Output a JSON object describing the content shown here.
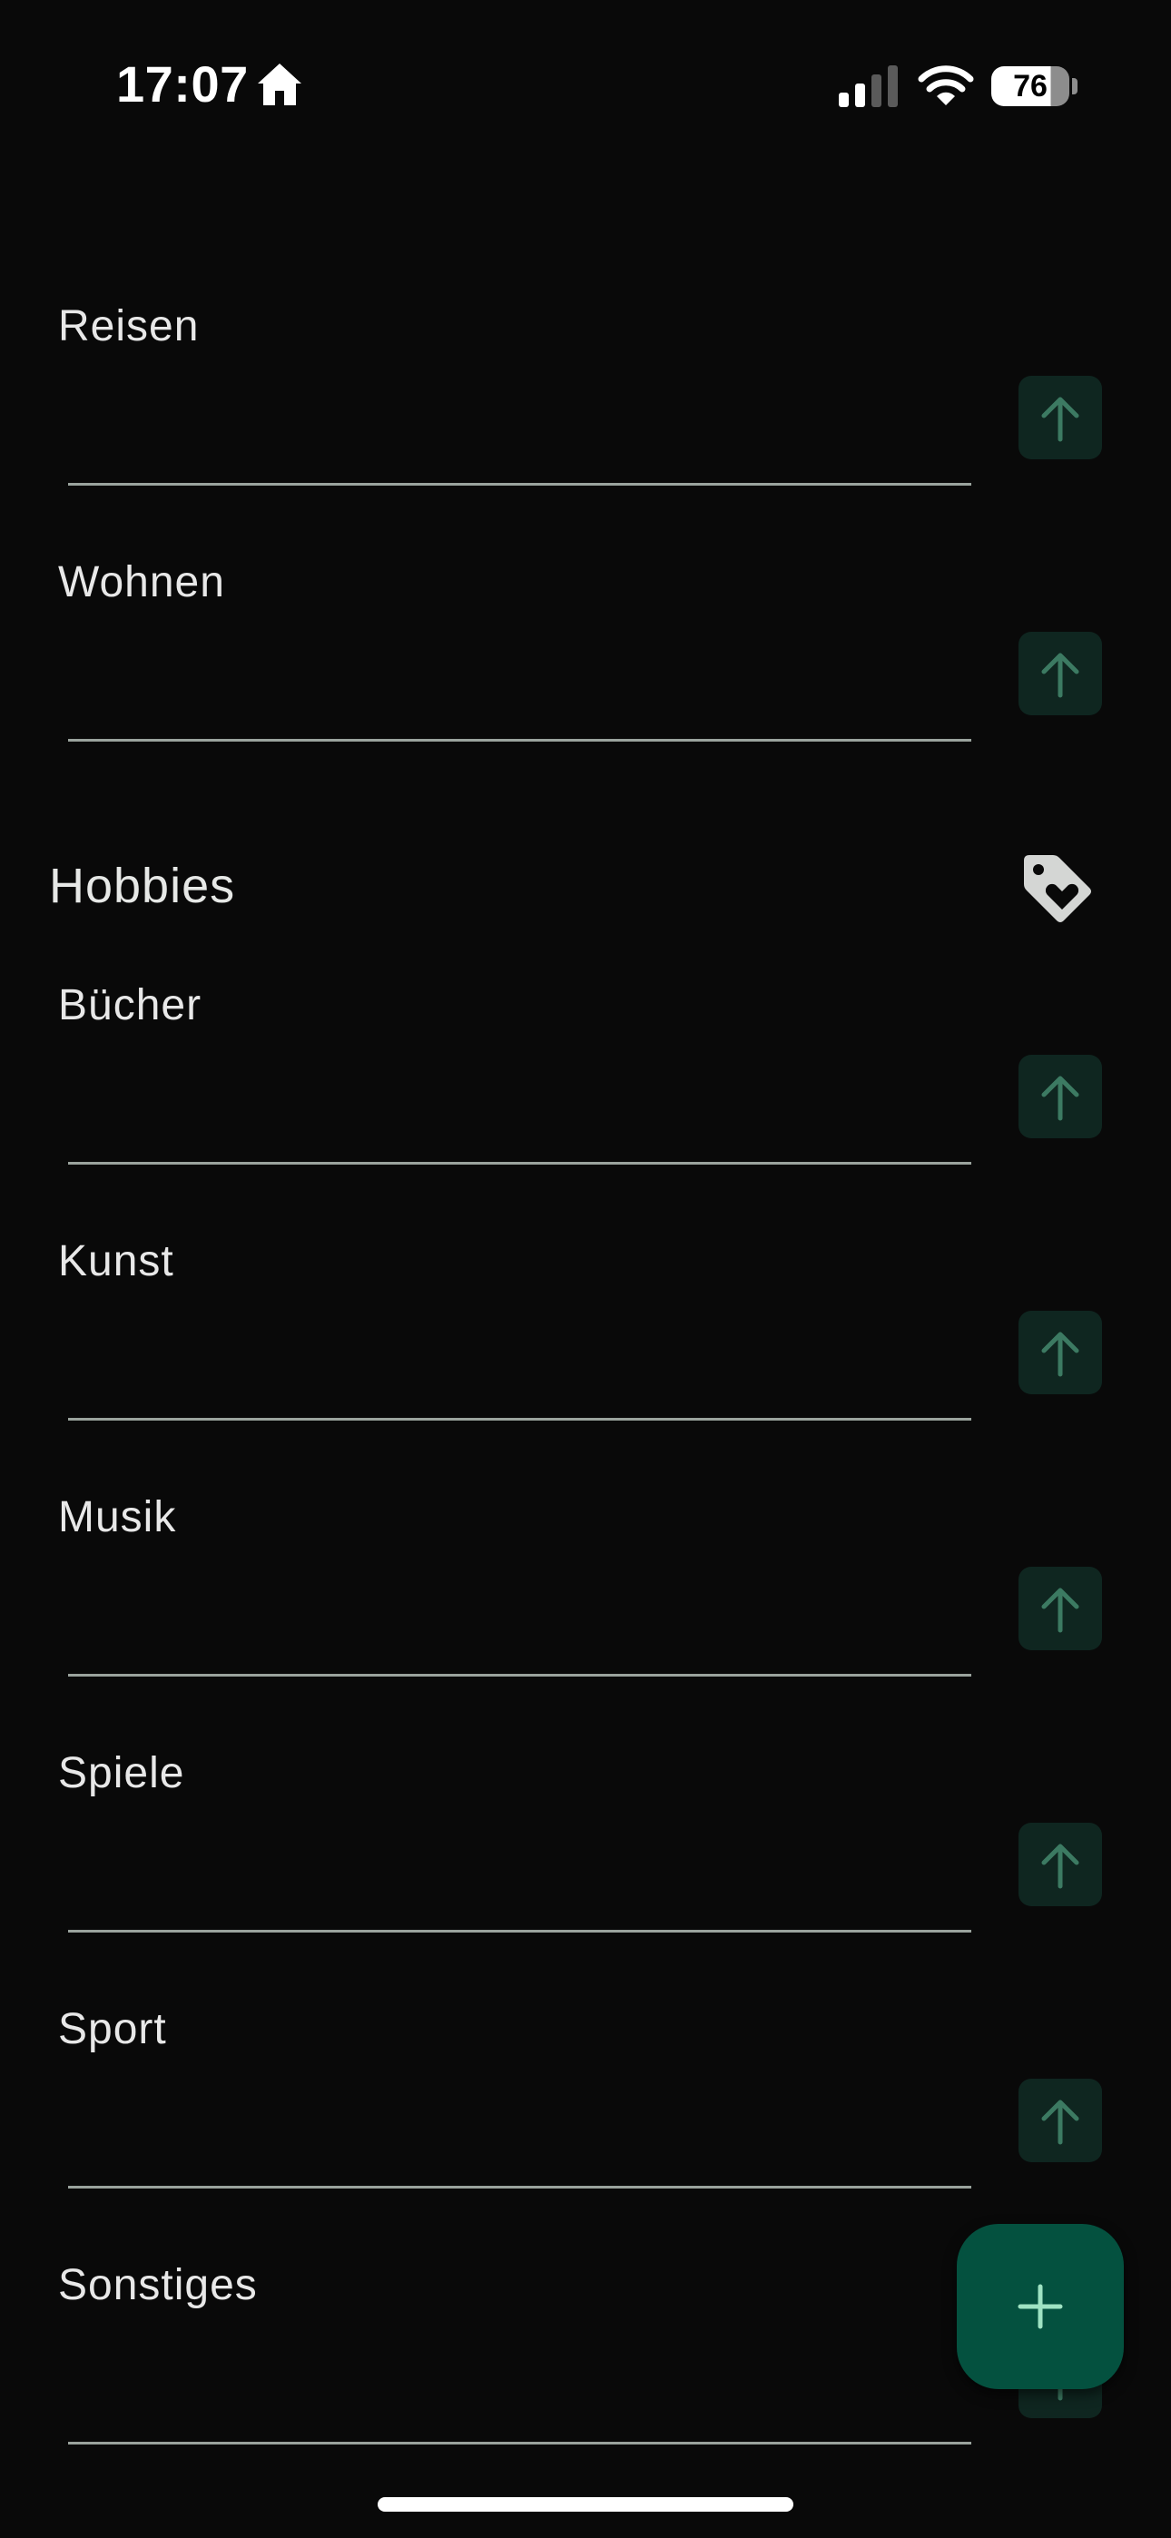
{
  "status_bar": {
    "time": "17:07",
    "battery_level": "76",
    "battery_fraction": 0.76
  },
  "sections": [
    {
      "title": "",
      "icon": "",
      "items": [
        {
          "label": ""
        },
        {
          "label": "Reisen"
        },
        {
          "label": "Wohnen"
        }
      ]
    },
    {
      "title": "Hobbies",
      "icon": "tag-heart-icon",
      "items": [
        {
          "label": "Bücher"
        },
        {
          "label": "Kunst"
        },
        {
          "label": "Musik"
        },
        {
          "label": "Spiele"
        },
        {
          "label": "Sport"
        },
        {
          "label": "Sonstiges"
        }
      ]
    }
  ],
  "icons": {
    "row_action": "arrow-up-icon",
    "fab": "plus-icon"
  },
  "colors": {
    "background": "#090909",
    "accent": "#04513f",
    "accent_icon": "#9fe3c3",
    "row_button": "#0f2620",
    "divider": "#9aa39d"
  }
}
